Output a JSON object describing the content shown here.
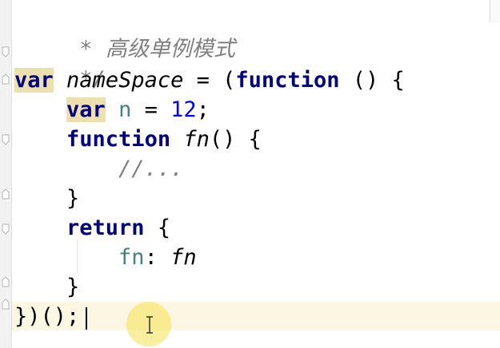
{
  "editor": {
    "lines": {
      "l1": {
        "star": "*",
        "text": "高级单例模式"
      },
      "l2": {
        "text": "*/"
      },
      "l3": {
        "var": "var",
        "name": "nameSpace",
        "eq": "=",
        "paren": "(",
        "fn": "function",
        "args": "()",
        "brace": "{"
      },
      "l4": {
        "var": "var",
        "n": "n",
        "eq": "=",
        "num": "12",
        "semi": ";"
      },
      "l5": {
        "fn": "function",
        "name": "fn",
        "args": "()",
        "brace": "{"
      },
      "l6": {
        "text": "//..."
      },
      "l7": {
        "text": "}"
      },
      "l8": {
        "ret": "return",
        "brace": "{"
      },
      "l9": {
        "key": "fn",
        "colon": ":",
        "val": "fn"
      },
      "l10": {
        "text": "}"
      },
      "l11": {
        "text": "})();"
      }
    }
  },
  "colors": {
    "keyword": "#000080",
    "keyword_highlight_bg": "#ece1ae",
    "comment": "#808080",
    "number": "#0000ff",
    "local_var": "#458383",
    "current_line_bg": "#fbf7e3",
    "cursor_halo": "#f6e250"
  },
  "icons": [
    "fold-marker-icon",
    "text-cursor-icon"
  ]
}
